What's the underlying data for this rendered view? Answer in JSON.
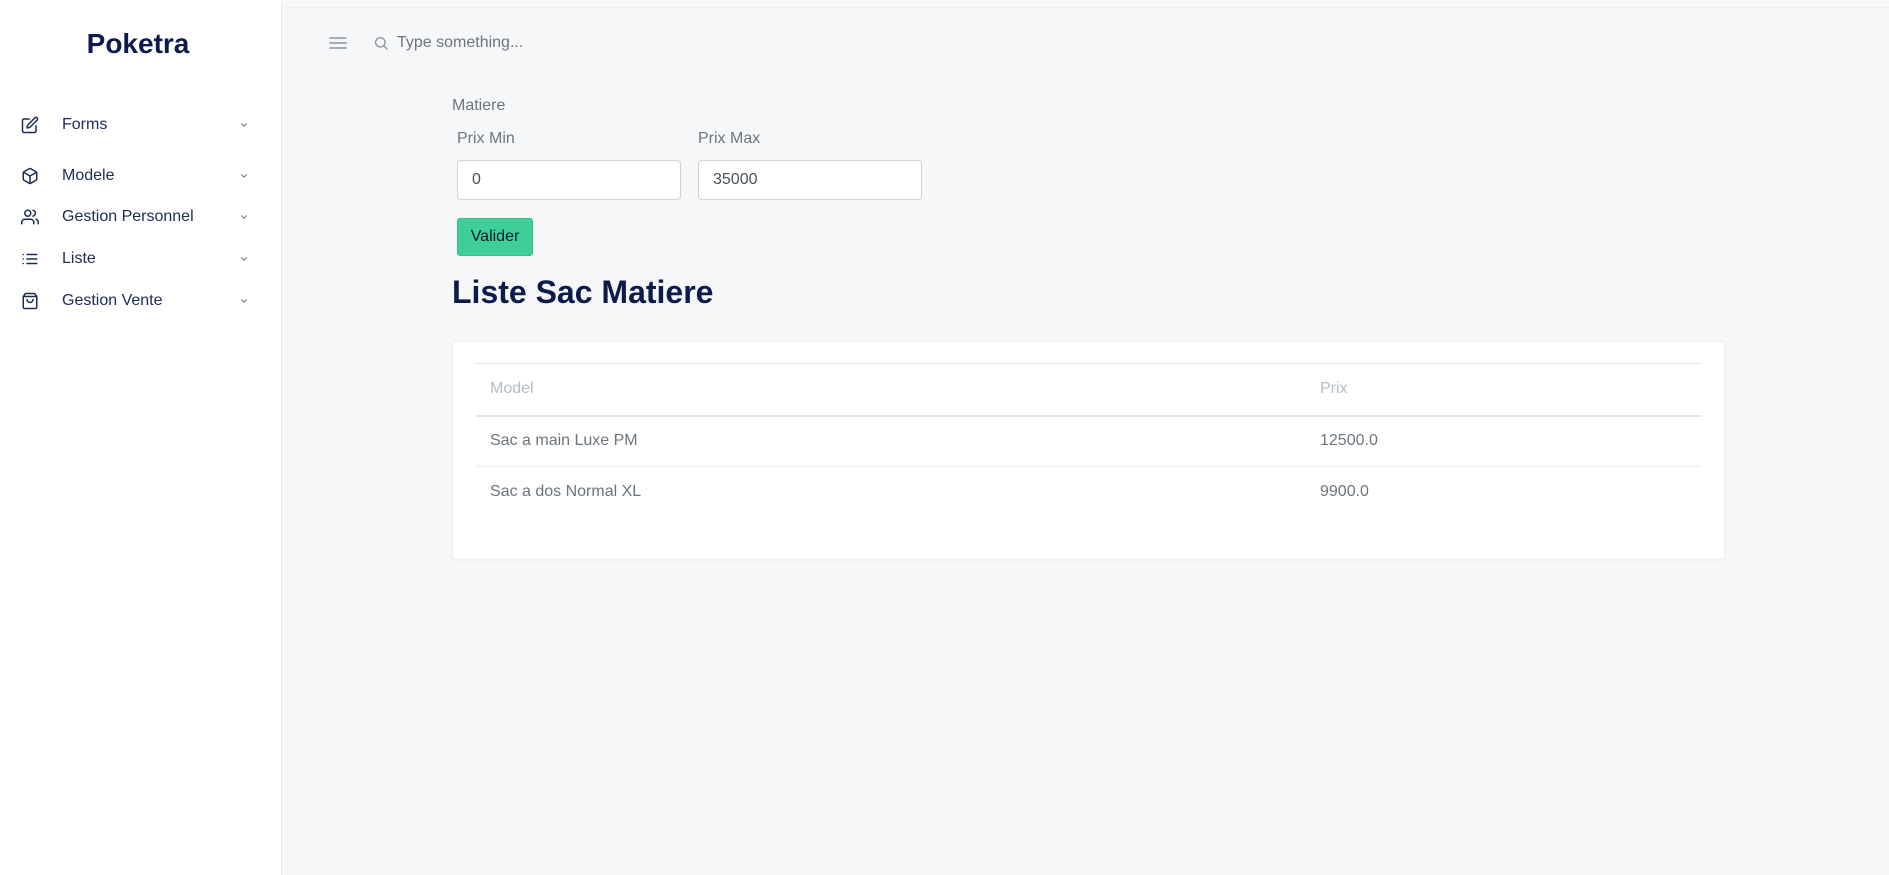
{
  "sidebar": {
    "brand": "Poketra",
    "items": [
      {
        "label": "Forms",
        "icon": "edit-icon"
      },
      {
        "label": "Modele",
        "icon": "cube-icon"
      },
      {
        "label": "Gestion Personnel",
        "icon": "users-icon"
      },
      {
        "label": "Liste",
        "icon": "list-icon"
      },
      {
        "label": "Gestion Vente",
        "icon": "shopping-bag-icon"
      }
    ]
  },
  "topbar": {
    "search_placeholder": "Type something..."
  },
  "filter": {
    "title": "Matiere",
    "min_label": "Prix Min",
    "min_value": "0",
    "max_label": "Prix Max",
    "max_value": "35000",
    "submit_label": "Valider"
  },
  "page_title": "Liste Sac Matiere",
  "table": {
    "headers": [
      "Model",
      "Prix"
    ],
    "rows": [
      [
        "Sac a main Luxe PM",
        "12500.0"
      ],
      [
        "Sac a dos Normal XL",
        "9900.0"
      ]
    ]
  },
  "colors": {
    "brand": "#0d1b4b",
    "accent_button": "#3ecf99"
  }
}
